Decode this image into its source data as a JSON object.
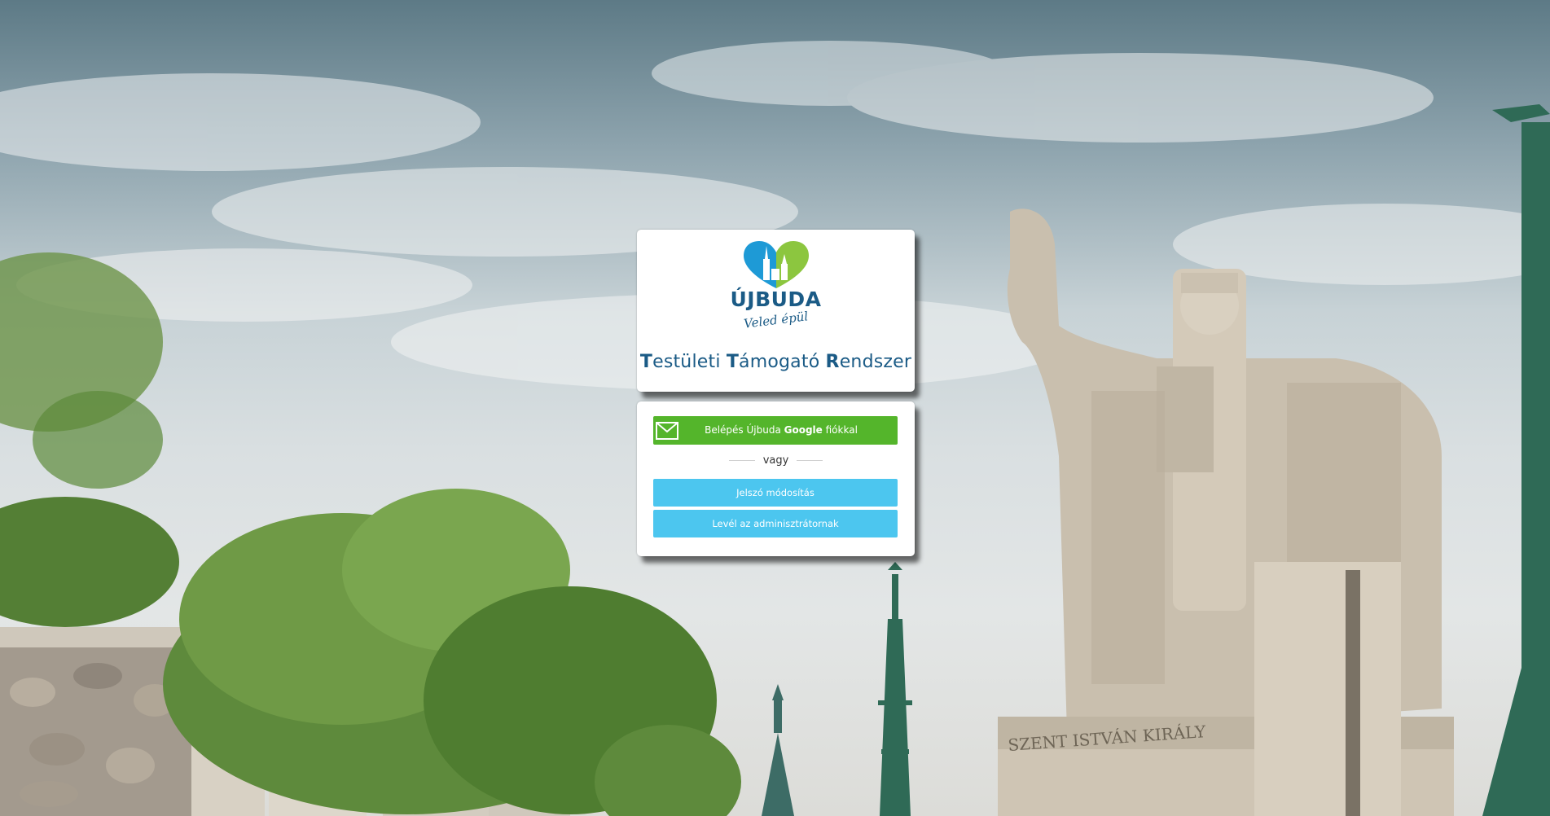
{
  "logo": {
    "name": "ÚJBUDA",
    "tagline": "Veled épül",
    "colors": {
      "green": "#8cc63f",
      "blue": "#1e9ad6",
      "dark_blue": "#1b5b86"
    }
  },
  "title": {
    "parts": [
      {
        "cap": "T",
        "rest": "estületi "
      },
      {
        "cap": "T",
        "rest": "ámogató "
      },
      {
        "cap": "R",
        "rest": "endszer"
      }
    ]
  },
  "login": {
    "google_button": {
      "prefix": "Belépés Újbuda ",
      "brand": "Google",
      "suffix": " fiókkal",
      "icon": "mail-icon",
      "color": "#54b52b"
    },
    "or_text": "vagy",
    "password_button": {
      "label": "Jelszó módosítás",
      "color": "#4cc6ef"
    },
    "admin_button": {
      "label": "Levél az adminisztrátornak",
      "color": "#4cc6ef"
    }
  },
  "background": {
    "statue_inscription": "SZENT ISTVÁN KIRÁLY"
  }
}
